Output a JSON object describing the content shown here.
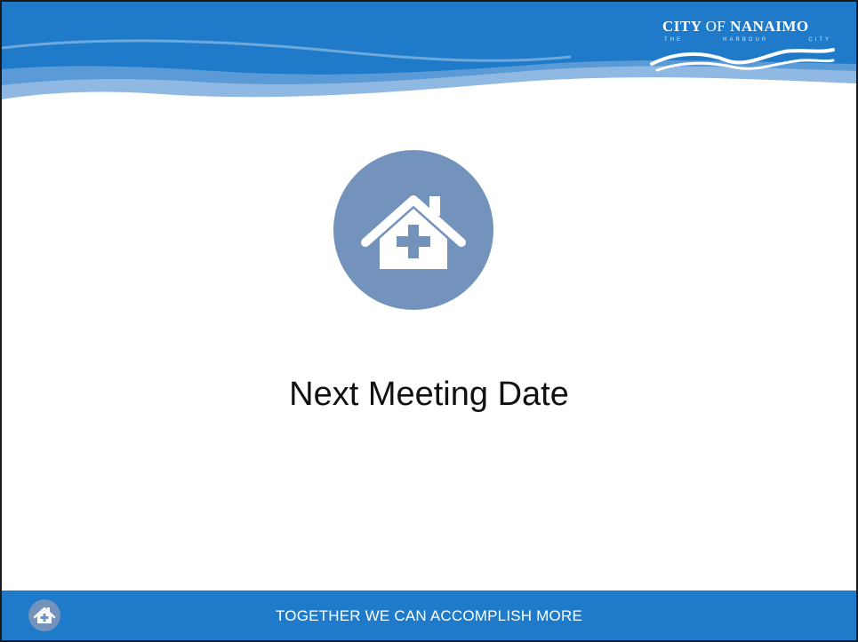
{
  "slide": {
    "title": "Next Meeting Date"
  },
  "logo": {
    "title_main": "CITY",
    "title_of": "OF",
    "title_name": "NANAIMO",
    "subtitle_parts": [
      "THE",
      "HARBOUR",
      "CITY"
    ]
  },
  "footer": {
    "tagline": "TOGETHER WE CAN ACCOMPLISH MORE"
  },
  "icons": {
    "hero": "home-health-icon",
    "footer": "home-health-icon"
  },
  "colors": {
    "header_blue": "#1f7bc9",
    "header_light_blue": "#8fb8e3",
    "icon_circle": "#7393bc",
    "footer_blue": "#1f7bc9",
    "title_text": "#111111"
  }
}
